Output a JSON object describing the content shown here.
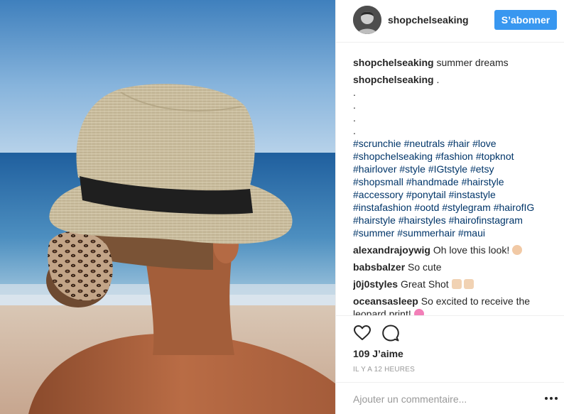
{
  "post": {
    "author": "shopchelseaking",
    "follow_label": "S’abonner",
    "image_icon": "photo-image"
  },
  "comments": [
    {
      "user": "shopchelseaking",
      "text": "summer dreams"
    },
    {
      "user": "shopchelseaking",
      "text": "."
    },
    {
      "user": "alexandrajoywig",
      "text": "Oh love this look!",
      "emoji": "ok-hand-emoji"
    },
    {
      "user": "babsbalzer",
      "text": "So cute"
    },
    {
      "user": "j0j0styles",
      "text": "Great Shot",
      "emoji": "thumbs-up-emoji"
    },
    {
      "user": "oceansasleep",
      "text": "So excited to receive the leopard print!",
      "emoji": "two-hearts-emoji"
    }
  ],
  "caption_dots": [
    ".",
    ".",
    ".",
    "."
  ],
  "hashtags": [
    "#scrunchie",
    "#neutrals",
    "#hair",
    "#love",
    "#shopchelseaking",
    "#fashion",
    "#topknot",
    "#hairlover",
    "#style",
    "#IGtstyle",
    "#etsy",
    "#shopsmall",
    "#handmade",
    "#hairstyle",
    "#accessory",
    "#ponytail",
    "#instastyle",
    "#instafashion",
    "#ootd",
    "#stylegram",
    "#hairofIG",
    "#hairstyle",
    "#hairstyles",
    "#hairofinstagram",
    "#summer",
    "#summerhair",
    "#maui"
  ],
  "actions": {
    "like_icon": "heart-icon",
    "comment_icon": "comment-bubble-icon"
  },
  "likes_label": "109 J’aime",
  "timestamp": "IL Y A 12 HEURES",
  "add_comment": {
    "placeholder": "Ajouter un commentaire...",
    "more_icon": "more-options-icon"
  },
  "colors": {
    "accent": "#3897f0",
    "hashtag": "#003569",
    "muted": "#999999"
  }
}
